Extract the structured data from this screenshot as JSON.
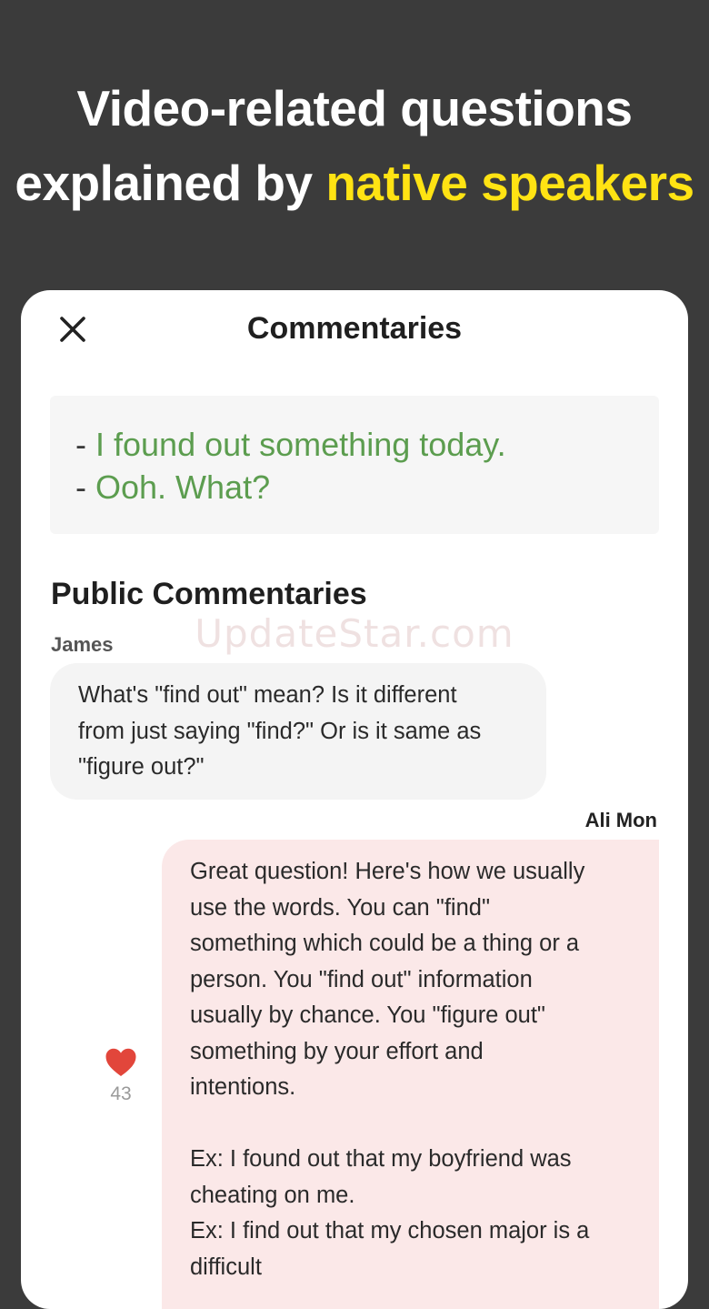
{
  "headline": {
    "line1": "Video-related questions",
    "line2_plain": "explained by ",
    "line2_accent": "native speakers",
    "accent_color": "#ffe313"
  },
  "watermark": "UpdateStar.com",
  "sheet": {
    "close_icon": "close-icon",
    "title": "Commentaries"
  },
  "quote": {
    "dash": "- ",
    "lines": [
      "I found out something today.",
      "Ooh. What?"
    ],
    "text_color": "#5c9d4f"
  },
  "public": {
    "title": "Public Commentaries",
    "comments": [
      {
        "author": "James",
        "lines": [
          "What's \"find out\" mean? Is it different",
          "from just saying \"find?\" Or is it same as",
          "\"figure out?\""
        ]
      },
      {
        "author": "Ali Mon",
        "likes": "43",
        "like_icon": "heart-icon",
        "like_color": "#e2463b",
        "lines": [
          "Great question! Here's how we usually",
          "use the words. You can \"find\"",
          "something which could be a thing or a",
          "person. You \"find out\" information",
          "usually by chance. You \"figure out\"",
          "something by your effort and",
          "intentions.",
          "",
          "Ex: I found out that my boyfriend was",
          "cheating on me.",
          "Ex: I find out that my chosen major is a",
          "difficult"
        ]
      }
    ]
  }
}
